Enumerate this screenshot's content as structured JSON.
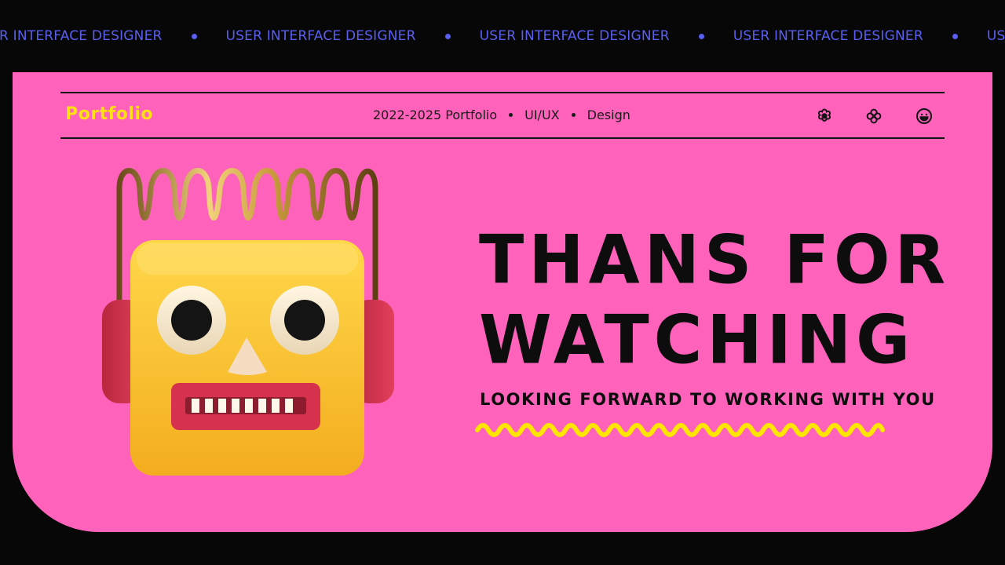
{
  "ticker": {
    "items": [
      "R INTERFACE DESIGNER",
      "USER INTERFACE DESIGNER",
      "USER INTERFACE DESIGNER",
      "USER INTERFACE DESIGNER",
      "USER INTERFACE DESIG"
    ],
    "color": "#5a5ff0"
  },
  "header": {
    "brand": "Portfolio",
    "nav": [
      "2022-2025 Portfolio",
      "UI/UX",
      "Design"
    ],
    "icons": [
      "flower-icon",
      "clover-icon",
      "smiley-icon"
    ]
  },
  "hero": {
    "title_line1": "THANS FOR",
    "title_line2": "WATCHING",
    "subtitle": "LOOKING FORWARD TO WORKING WITH YOU"
  },
  "colors": {
    "background": "#070707",
    "card": "#ff62bb",
    "brand_yellow": "#ffe014",
    "squiggle": "#ffe600"
  }
}
